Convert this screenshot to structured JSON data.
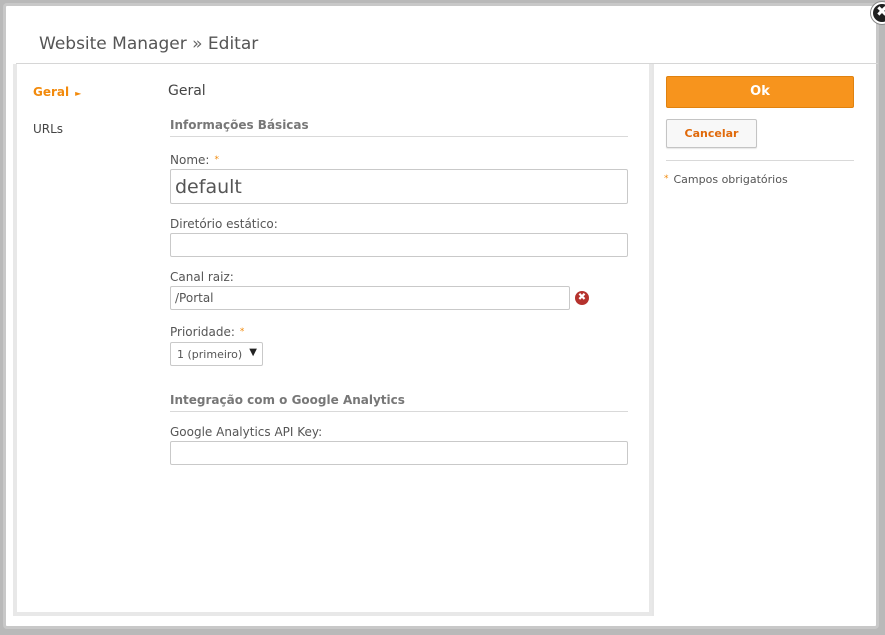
{
  "window": {
    "title_app": "Website Manager",
    "title_sep": "»",
    "title_action": "Editar",
    "close_glyph": "✖"
  },
  "nav": {
    "items": [
      {
        "label": "Geral",
        "active": true
      },
      {
        "label": "URLs",
        "active": false
      }
    ],
    "active_arrow": "►"
  },
  "form": {
    "section_title": "Geral",
    "basic_group_title": "Informações Básicas",
    "required_mark": "*",
    "name": {
      "label": "Nome:",
      "value": "default",
      "required": true
    },
    "static_dir": {
      "label": "Diretório estático:",
      "value": ""
    },
    "root_channel": {
      "label": "Canal raiz:",
      "value": "/Portal",
      "clear_glyph": "✖"
    },
    "priority": {
      "label": "Prioridade:",
      "value": "1 (primeiro)",
      "caret": "▼",
      "required": true
    },
    "analytics_group_title": "Integração com o Google Analytics",
    "analytics_key": {
      "label": "Google Analytics API Key:",
      "value": ""
    }
  },
  "actions": {
    "ok_label": "Ok",
    "cancel_label": "Cancelar",
    "required_note": "Campos obrigatórios"
  },
  "colors": {
    "accent": "#f7941d",
    "accent_text": "#f28a0c",
    "error": "#b5322d"
  }
}
